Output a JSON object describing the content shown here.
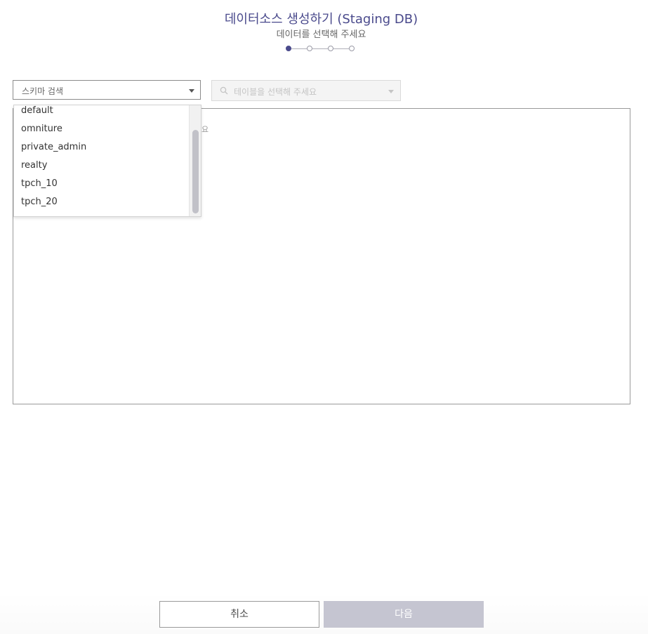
{
  "header": {
    "title": "데이터소스 생성하기 (Staging DB)",
    "subtitle": "데이터를 선택해 주세요"
  },
  "stepper": {
    "total_steps": 4,
    "current_step": 1
  },
  "schema_select": {
    "value": "스키마 검색",
    "options": [
      "default",
      "omniture",
      "private_admin",
      "realty",
      "tpch_10",
      "tpch_20"
    ]
  },
  "table_select": {
    "placeholder": "테이블을 선택해 주세요"
  },
  "main_panel": {
    "empty_text_visible": "요"
  },
  "footer": {
    "cancel_label": "취소",
    "next_label": "다음"
  },
  "colors": {
    "accent": "#4a4a8c",
    "disabled_button": "#c5c5d1"
  },
  "icons": {
    "schema_caret": "chevron-down-icon",
    "table_search": "search-icon",
    "table_caret": "chevron-down-icon"
  }
}
